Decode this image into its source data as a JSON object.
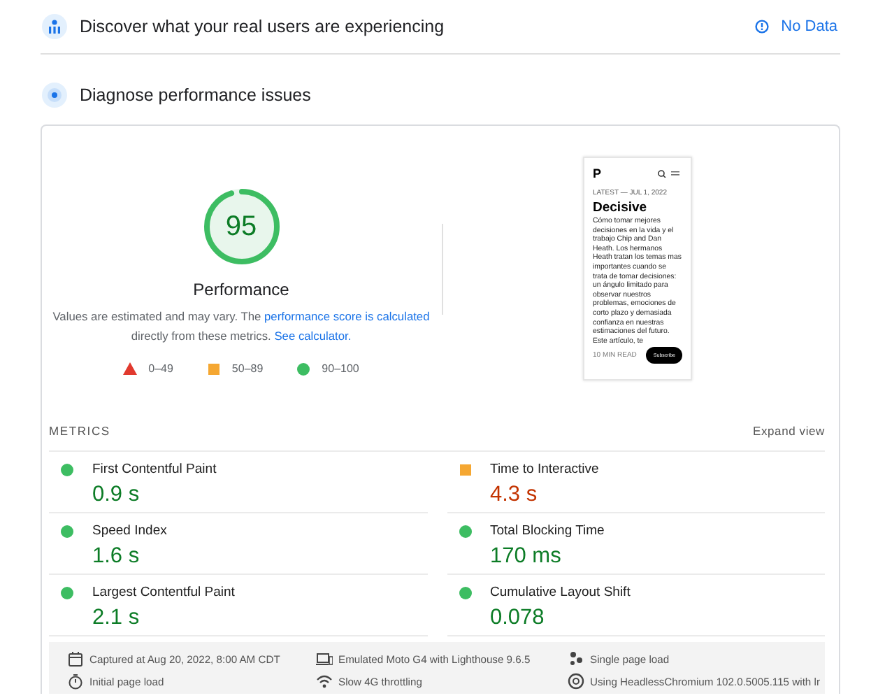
{
  "sections": [
    {
      "kind": "field",
      "title": "Discover what your real users are experiencing",
      "status": "No Data"
    },
    {
      "kind": "lab",
      "title": "Diagnose performance issues"
    }
  ],
  "gauge": {
    "score": "95",
    "level": 0.95,
    "label": "Performance"
  },
  "note": [
    {
      "text": "Values are estimated and may vary. The ",
      "link": false
    },
    {
      "text": "performance score is calculated",
      "link": true
    },
    {
      "text": " directly from these metrics. ",
      "link": false
    },
    {
      "text": "See calculator.",
      "link": true
    }
  ],
  "legend": [
    {
      "kind": "fail",
      "range": "0–49"
    },
    {
      "kind": "average",
      "range": "50–89"
    },
    {
      "kind": "pass",
      "range": "90–100"
    }
  ],
  "thumbnail": {
    "logo": "P",
    "meta": "LATEST — JUL 1, 2022",
    "headline": "Decisive",
    "body": "Cómo tomar mejores decisiones en la vida y el trabajo Chip and Dan Heath. Los hermanos Heath tratan los temas mas importantes cuando se trata de tomar decisiones: un ángulo limitado para observar nuestros problemas, emociones de corto plazo y demasiada confianza en nuestras estimaciones del futuro. Este artículo, te",
    "footer": "10 MIN READ",
    "button": "Subscribe"
  },
  "metrics_header": {
    "title": "METRICS",
    "action": "Expand view"
  },
  "metrics": [
    {
      "name": "First Contentful Paint",
      "value": "0.9 s",
      "kind": "pass"
    },
    {
      "name": "Time to Interactive",
      "value": "4.3 s",
      "kind": "average"
    },
    {
      "name": "Speed Index",
      "value": "1.6 s",
      "kind": "pass"
    },
    {
      "name": "Total Blocking Time",
      "value": "170 ms",
      "kind": "pass"
    },
    {
      "name": "Largest Contentful Paint",
      "value": "2.1 s",
      "kind": "pass"
    },
    {
      "name": "Cumulative Layout Shift",
      "value": "0.078",
      "kind": "pass"
    }
  ],
  "runtime": [
    {
      "kind": "calendar",
      "text": "Captured at Aug 20, 2022, 8:00 AM CDT"
    },
    {
      "kind": "device",
      "text": "Emulated Moto G4 with Lighthouse 9.6.5"
    },
    {
      "kind": "users",
      "text": "Single page load"
    },
    {
      "kind": "timer",
      "text": "Initial page load"
    },
    {
      "kind": "signal",
      "text": "Slow 4G throttling"
    },
    {
      "kind": "browser",
      "text": "Using HeadlessChromium 102.0.5005.115 with lr"
    }
  ]
}
